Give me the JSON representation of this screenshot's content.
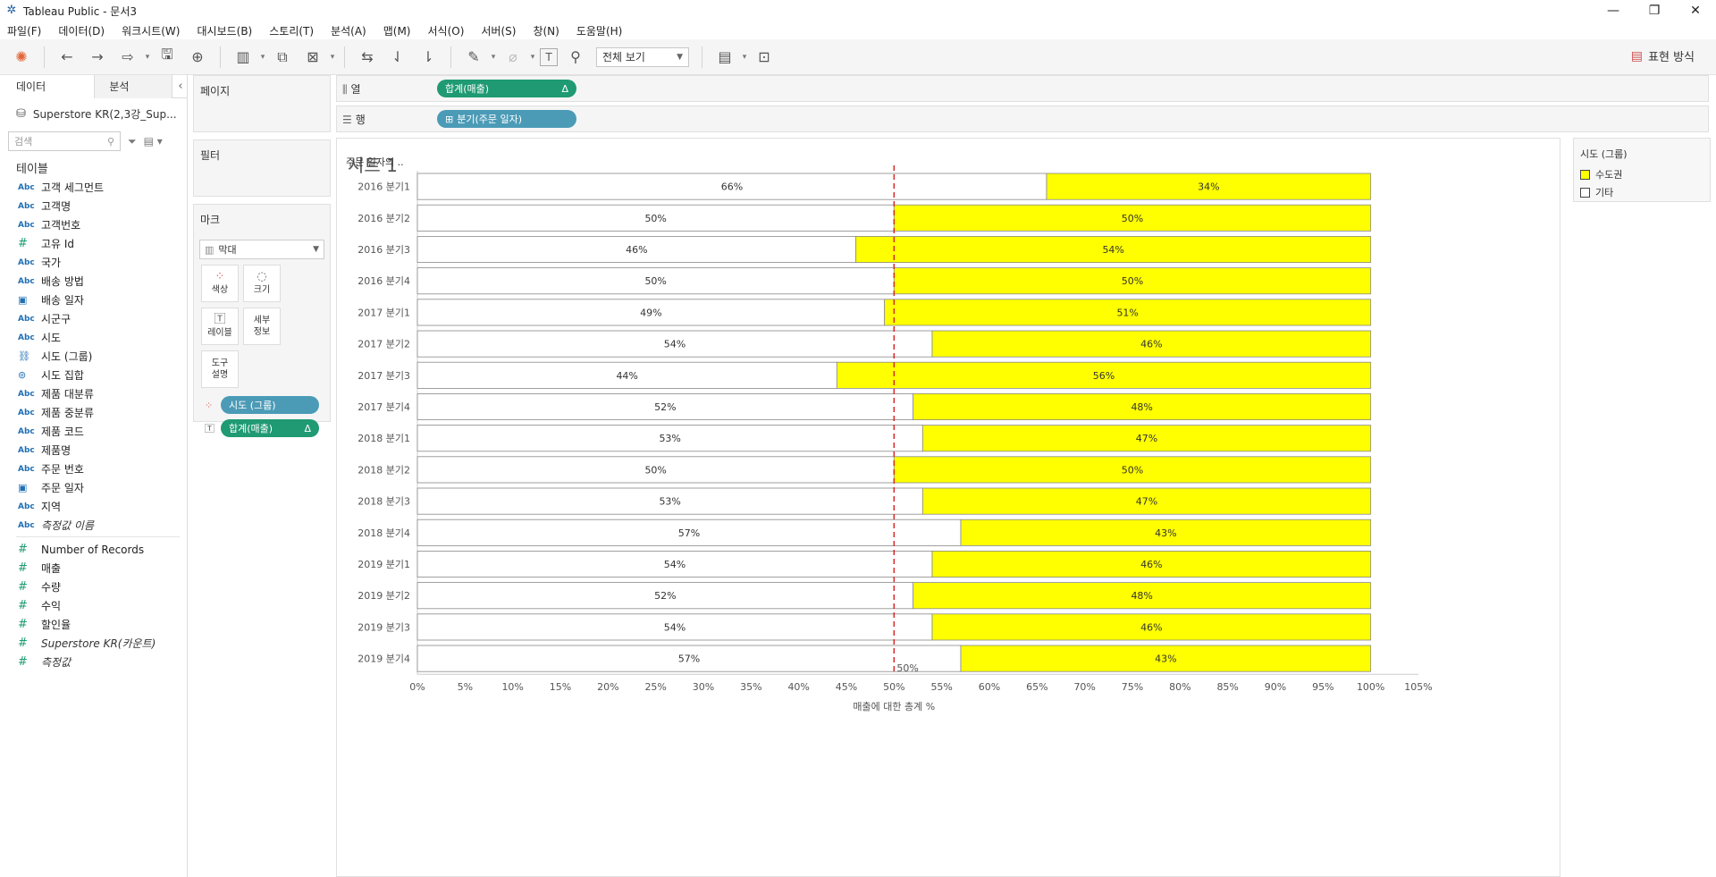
{
  "window": {
    "title": "Tableau Public - 문서3",
    "minimize": "—",
    "restore": "❐",
    "close": "✕"
  },
  "menu": [
    "파일(F)",
    "데이터(D)",
    "워크시트(W)",
    "대시보드(B)",
    "스토리(T)",
    "분석(A)",
    "맵(M)",
    "서식(O)",
    "서버(S)",
    "창(N)",
    "도움말(H)"
  ],
  "toolbar": {
    "view_mode": "전체 보기",
    "show_me": "표현 방식"
  },
  "data_pane": {
    "tab_data": "데이터",
    "tab_analysis": "분석",
    "datasource": "Superstore KR(2,3강_Sup...",
    "search_placeholder": "검색",
    "tables_title": "테이블",
    "dimensions": [
      {
        "type": "Abc",
        "name": "고객 세그먼트"
      },
      {
        "type": "Abc",
        "name": "고객명"
      },
      {
        "type": "Abc",
        "name": "고객번호"
      },
      {
        "type": "#",
        "name": "고유 Id"
      },
      {
        "type": "Abc",
        "name": "국가"
      },
      {
        "type": "Abc",
        "name": "배송 방법"
      },
      {
        "type": "date",
        "name": "배송 일자"
      },
      {
        "type": "Abc",
        "name": "시군구"
      },
      {
        "type": "Abc",
        "name": "시도"
      },
      {
        "type": "link",
        "name": "시도 (그룹)"
      },
      {
        "type": "set",
        "name": "시도 집합"
      },
      {
        "type": "Abc",
        "name": "제품 대분류"
      },
      {
        "type": "Abc",
        "name": "제품 중분류"
      },
      {
        "type": "Abc",
        "name": "제품 코드"
      },
      {
        "type": "Abc",
        "name": "제품명"
      },
      {
        "type": "Abc",
        "name": "주문 번호"
      },
      {
        "type": "date",
        "name": "주문 일자"
      },
      {
        "type": "Abc",
        "name": "지역"
      },
      {
        "type": "Abc",
        "name": "측정값 이름",
        "italic": true
      }
    ],
    "measures": [
      {
        "name": "Number of Records"
      },
      {
        "name": "매출"
      },
      {
        "name": "수량"
      },
      {
        "name": "수익"
      },
      {
        "name": "할인율"
      },
      {
        "name": "Superstore KR(카운트)",
        "italic": true
      },
      {
        "name": "측정값",
        "italic": true
      }
    ]
  },
  "cards": {
    "pages": "페이지",
    "filters": "필터",
    "marks": "마크",
    "mark_type": "막대",
    "buttons": {
      "color": "색상",
      "size": "크기",
      "label": "레이블",
      "detail": "세부\n정보",
      "tooltip": "도구\n설명"
    },
    "pill_color": "시도 (그룹)",
    "pill_label": "합계(매출)",
    "delta": "Δ"
  },
  "shelves": {
    "columns_label": "열",
    "columns_pill": "합계(매출)",
    "rows_label": "행",
    "rows_pill": "분기(주문 일자)"
  },
  "sheet": {
    "title": "시트 1"
  },
  "legend": {
    "title": "시도 (그룹)",
    "items": [
      {
        "name": "수도권",
        "color": "#ffff00"
      },
      {
        "name": "기타",
        "color": "#ffffff"
      }
    ]
  },
  "chart_data": {
    "type": "bar",
    "stacked": true,
    "categories": [
      "2016 분기1",
      "2016 분기2",
      "2016 분기3",
      "2016 분기4",
      "2017 분기1",
      "2017 분기2",
      "2017 분기3",
      "2017 분기4",
      "2018 분기1",
      "2018 분기2",
      "2018 분기3",
      "2018 분기4",
      "2019 분기1",
      "2019 분기2",
      "2019 분기3",
      "2019 분기4"
    ],
    "series": [
      {
        "name": "기타",
        "color": "#ffffff",
        "values": [
          66,
          50,
          46,
          50,
          49,
          54,
          44,
          52,
          53,
          50,
          53,
          57,
          54,
          52,
          54,
          57
        ]
      },
      {
        "name": "수도권",
        "color": "#ffff00",
        "values": [
          34,
          50,
          54,
          50,
          51,
          46,
          56,
          48,
          47,
          50,
          47,
          43,
          46,
          48,
          46,
          43
        ]
      }
    ],
    "value_labels": {
      "기타": [
        "66%",
        "50%",
        "46%",
        "50%",
        "49%",
        "54%",
        "44%",
        "52%",
        "53%",
        "50%",
        "53%",
        "57%",
        "54%",
        "52%",
        "54%",
        "57%"
      ],
      "수도권": [
        "34%",
        "50%",
        "54%",
        "50%",
        "51%",
        "46%",
        "56%",
        "48%",
        "47%",
        "50%",
        "47%",
        "43%",
        "46%",
        "48%",
        "46%",
        "43%"
      ]
    },
    "row_header": "주문 일자의 ..",
    "xlabel": "매출에 대한 총계 %",
    "xlim": [
      0,
      105
    ],
    "xticks": [
      "0%",
      "5%",
      "10%",
      "15%",
      "20%",
      "25%",
      "30%",
      "35%",
      "40%",
      "45%",
      "50%",
      "55%",
      "60%",
      "65%",
      "70%",
      "75%",
      "80%",
      "85%",
      "90%",
      "95%",
      "100%",
      "105%"
    ],
    "reference_line": {
      "value": 50,
      "label": "50%",
      "color": "#d62728"
    }
  }
}
